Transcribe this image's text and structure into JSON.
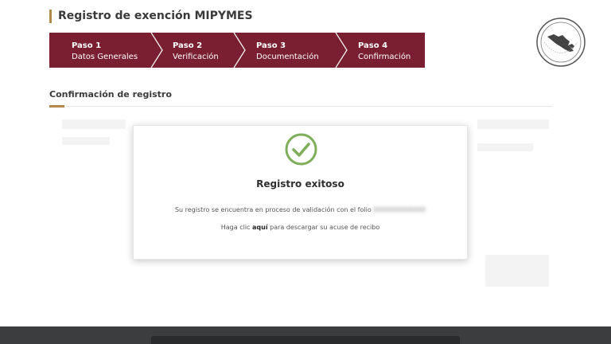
{
  "header": {
    "title": "Registro de exención MIPYMES"
  },
  "steps": [
    {
      "title": "Paso 1",
      "subtitle": "Datos Generales"
    },
    {
      "title": "Paso 2",
      "subtitle": "Verificación"
    },
    {
      "title": "Paso 3",
      "subtitle": "Documentación"
    },
    {
      "title": "Paso 4",
      "subtitle": "Confirmación"
    }
  ],
  "section": {
    "title": "Confirmación de registro"
  },
  "confirmation": {
    "title": "Registro exitoso",
    "message": "Su registro se encuentra en proceso de validación con el folio",
    "folio": "XXXXXXXXXXXX",
    "download_prefix": "Haga clic",
    "download_link": "aquí",
    "download_suffix": "para descargar su acuse de recibo"
  },
  "colors": {
    "step_bg": "#7a1e31",
    "accent": "#b08a4a",
    "success": "#7fae5a"
  }
}
